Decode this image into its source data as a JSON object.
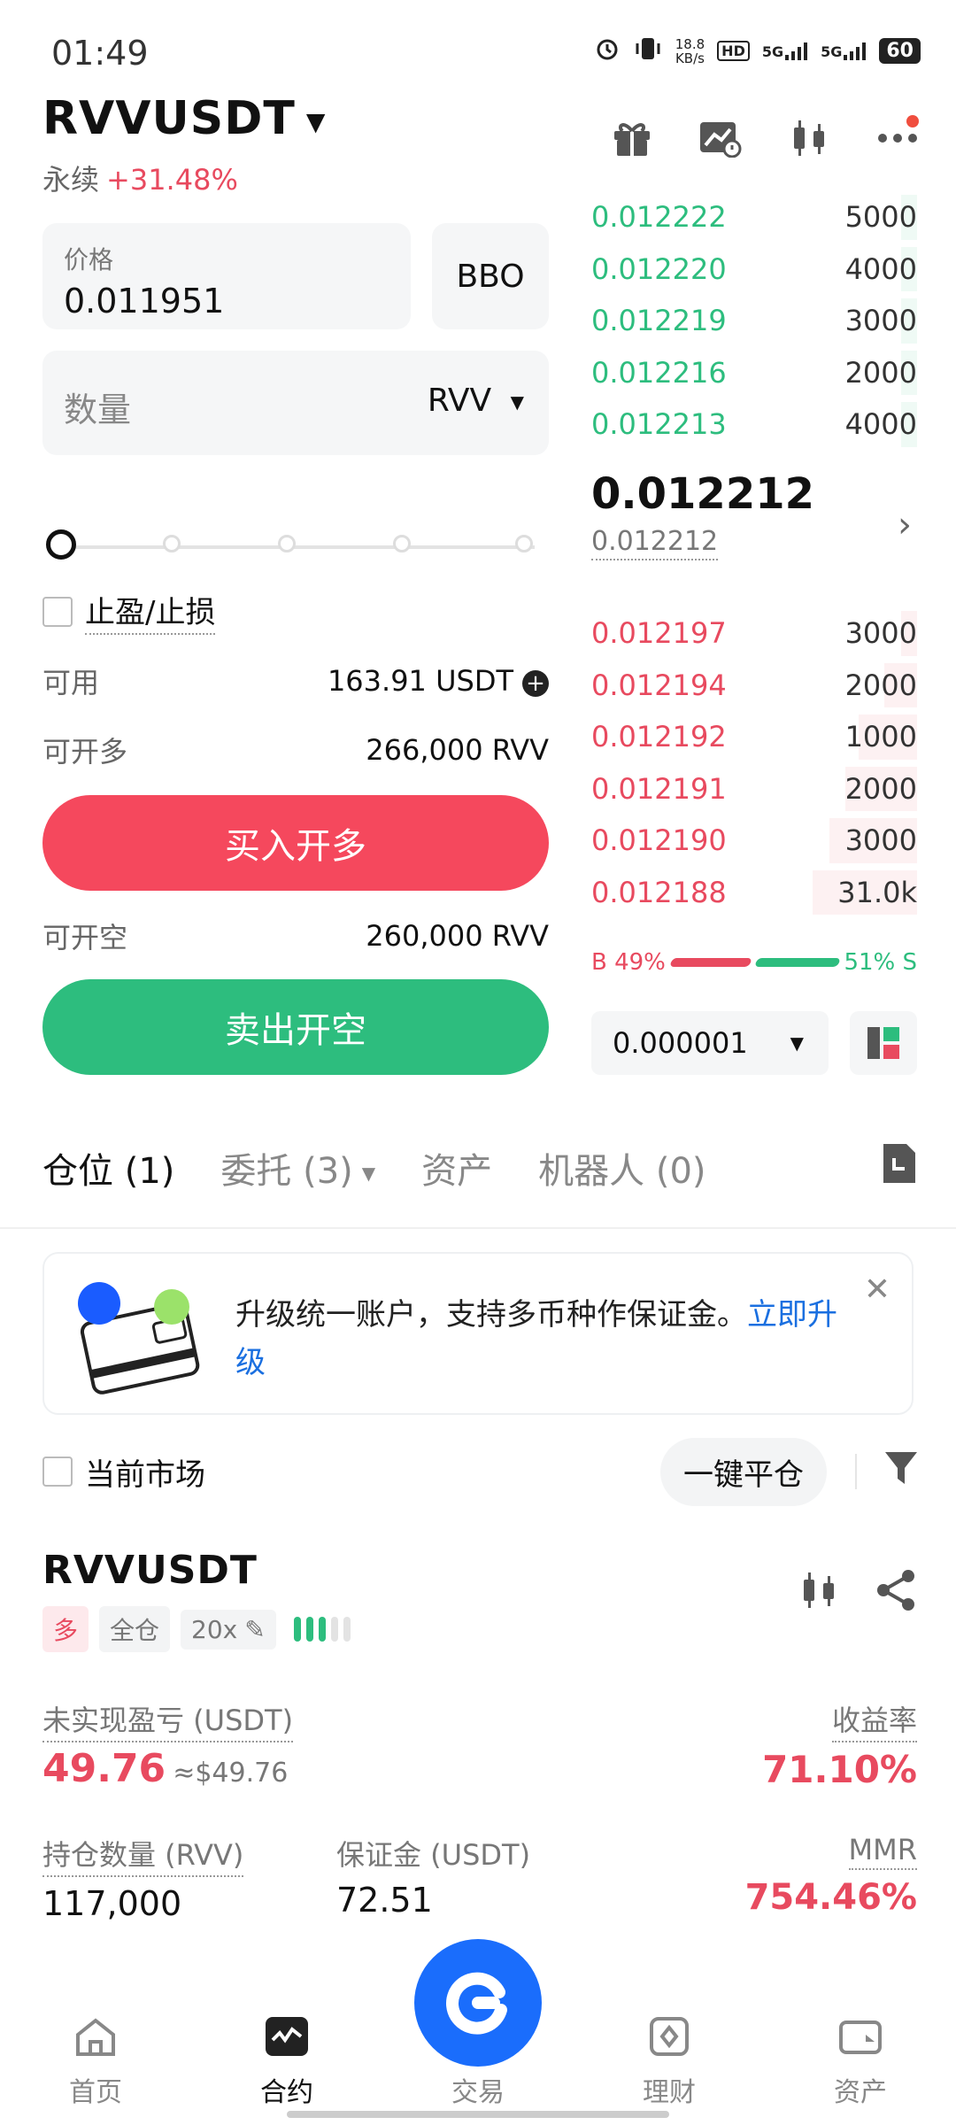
{
  "status_bar": {
    "time": "01:49",
    "net_speed": "18.8",
    "net_unit": "KB/s",
    "hd": "HD",
    "sig1": "5G",
    "sig2": "5G",
    "battery": "60"
  },
  "header": {
    "symbol": "RVVUSDT",
    "type": "永续",
    "change": "+31.48%"
  },
  "order_form": {
    "price_label": "价格",
    "price_value": "0.011951",
    "bbo_label": "BBO",
    "qty_placeholder": "数量",
    "qty_unit": "RVV",
    "slider_fraction": 0,
    "tpsl_label": "止盈/止损",
    "available_label": "可用",
    "available_value": "163.91 USDT",
    "max_long_label": "可开多",
    "max_long_value": "266,000 RVV",
    "buy_label": "买入开多",
    "max_short_label": "可开空",
    "max_short_value": "260,000 RVV",
    "sell_label": "卖出开空"
  },
  "order_book": {
    "asks": [
      {
        "price": "0.012222",
        "qty": "5000",
        "depth": 0.05
      },
      {
        "price": "0.012220",
        "qty": "4000",
        "depth": 0.05
      },
      {
        "price": "0.012219",
        "qty": "3000",
        "depth": 0.05
      },
      {
        "price": "0.012216",
        "qty": "2000",
        "depth": 0.05
      },
      {
        "price": "0.012213",
        "qty": "4000",
        "depth": 0.05
      }
    ],
    "last_price": "0.012212",
    "mark_price": "0.012212",
    "bids": [
      {
        "price": "0.012197",
        "qty": "3000",
        "depth": 0.05
      },
      {
        "price": "0.012194",
        "qty": "2000",
        "depth": 0.1
      },
      {
        "price": "0.012192",
        "qty": "1000",
        "depth": 0.18
      },
      {
        "price": "0.012191",
        "qty": "2000",
        "depth": 0.22
      },
      {
        "price": "0.012190",
        "qty": "3000",
        "depth": 0.27
      },
      {
        "price": "0.012188",
        "qty": "31.0k",
        "depth": 0.32
      }
    ],
    "buy_ratio_label": "B 49%",
    "sell_ratio_label": "51% S",
    "buy_ratio": 0.49,
    "sell_ratio": 0.51,
    "precision": "0.000001"
  },
  "tabs": [
    {
      "label": "仓位 (1)"
    },
    {
      "label": "委托 (3)"
    },
    {
      "label": "资产"
    },
    {
      "label": "机器人 (0)"
    }
  ],
  "banner": {
    "text": "升级统一账户，支持多币种作保证金。",
    "link": "立即升级"
  },
  "filter": {
    "current_market": "当前市场",
    "close_all": "一键平仓"
  },
  "position": {
    "symbol": "RVVUSDT",
    "side_tag": "多",
    "margin_mode": "全仓",
    "leverage": "20x",
    "upnl_label": "未实现盈亏 (USDT)",
    "upnl_value": "49.76",
    "upnl_approx": "≈$49.76",
    "roe_label": "收益率",
    "roe_value": "71.10%",
    "size_label": "持仓数量 (RVV)",
    "size_value": "117,000",
    "margin_label": "保证金 (USDT)",
    "margin_value": "72.51",
    "mmr_label": "MMR",
    "mmr_value": "754.46%"
  },
  "bottom_nav": [
    {
      "label": "首页",
      "icon": "home-icon"
    },
    {
      "label": "合约",
      "icon": "futures-icon"
    },
    {
      "label": "交易",
      "icon": "trade-icon"
    },
    {
      "label": "理财",
      "icon": "earn-icon"
    },
    {
      "label": "资产",
      "icon": "wallet-icon"
    }
  ],
  "colors": {
    "green": "#2dbd7e",
    "red": "#e84a5f",
    "buy_button": "#f5485d",
    "accent_blue": "#1a6dfc"
  }
}
